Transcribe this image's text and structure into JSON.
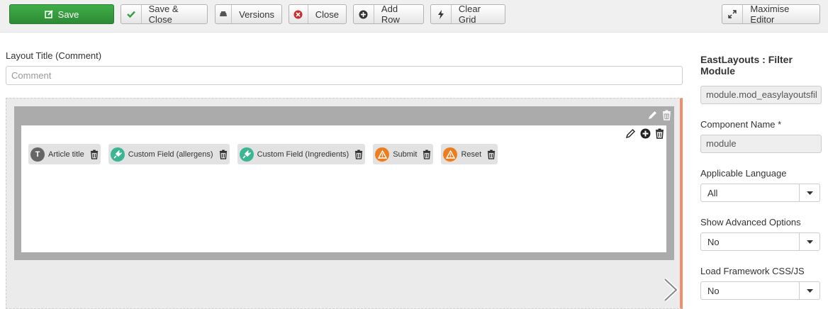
{
  "toolbar": {
    "save": "Save",
    "save_close": "Save & Close",
    "versions": "Versions",
    "close": "Close",
    "add_row": "Add Row",
    "clear_grid": "Clear Grid",
    "maximise": "Maximise Editor"
  },
  "layout_title": {
    "label": "Layout Title (Comment)",
    "placeholder": "Comment",
    "value": ""
  },
  "grid": {
    "items": [
      {
        "label": "Article title",
        "icon": "text-T-icon",
        "color": "#666666"
      },
      {
        "label": "Custom Field (allergens)",
        "icon": "plug-icon",
        "color": "#3bb592"
      },
      {
        "label": "Custom Field (Ingredients)",
        "icon": "plug-icon",
        "color": "#3bb592"
      },
      {
        "label": "Submit",
        "icon": "warning-icon",
        "color": "#ee7d1d"
      },
      {
        "label": "Reset",
        "icon": "warning-icon",
        "color": "#ee7d1d"
      }
    ],
    "badge_letter": "T"
  },
  "sidebar": {
    "title": "EastLayouts : Filter Module",
    "module_value": "module.mod_easylayoutsfil",
    "component_label": "Component Name *",
    "component_value": "module",
    "language_label": "Applicable Language",
    "language_value": "All",
    "advanced_label": "Show Advanced Options",
    "advanced_value": "No",
    "framework_label": "Load Framework CSS/JS",
    "framework_value": "No"
  },
  "colors": {
    "save_green": "#3fae48",
    "accent_orange": "#f0916b",
    "field_teal": "#3bb592",
    "warning_orange": "#ee7d1d"
  }
}
